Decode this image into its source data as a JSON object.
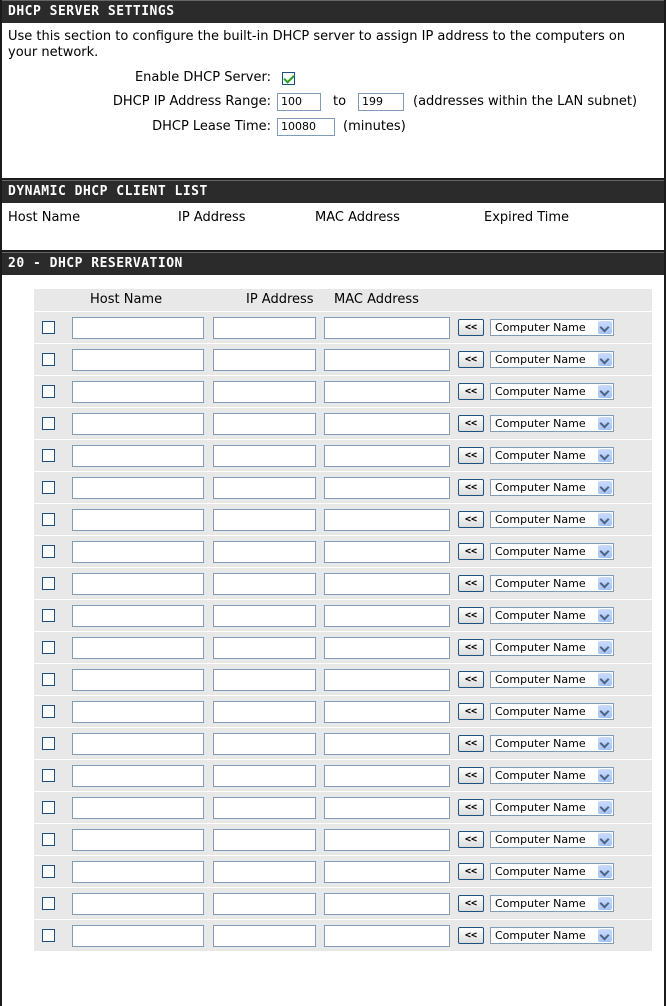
{
  "settings": {
    "header": "DHCP SERVER SETTINGS",
    "description": "Use this section to configure the built-in DHCP server to assign IP address to the computers on your network.",
    "enable_label": "Enable DHCP Server:",
    "enable_checked": true,
    "range_label": "DHCP IP Address Range:",
    "range_start": "100",
    "range_to": "to",
    "range_end": "199",
    "range_note": "(addresses within the LAN subnet)",
    "lease_label": "DHCP Lease Time:",
    "lease_value": "10080",
    "lease_unit": "(minutes)"
  },
  "client_list": {
    "header": "DYNAMIC DHCP CLIENT LIST",
    "columns": [
      "Host Name",
      "IP Address",
      "MAC Address",
      "Expired Time"
    ]
  },
  "reservation": {
    "header": "20 - DHCP RESERVATION",
    "columns": [
      "Host Name",
      "IP Address",
      "MAC Address"
    ],
    "copy_button": "<<",
    "select_value": "Computer Name",
    "row_count": 20
  }
}
